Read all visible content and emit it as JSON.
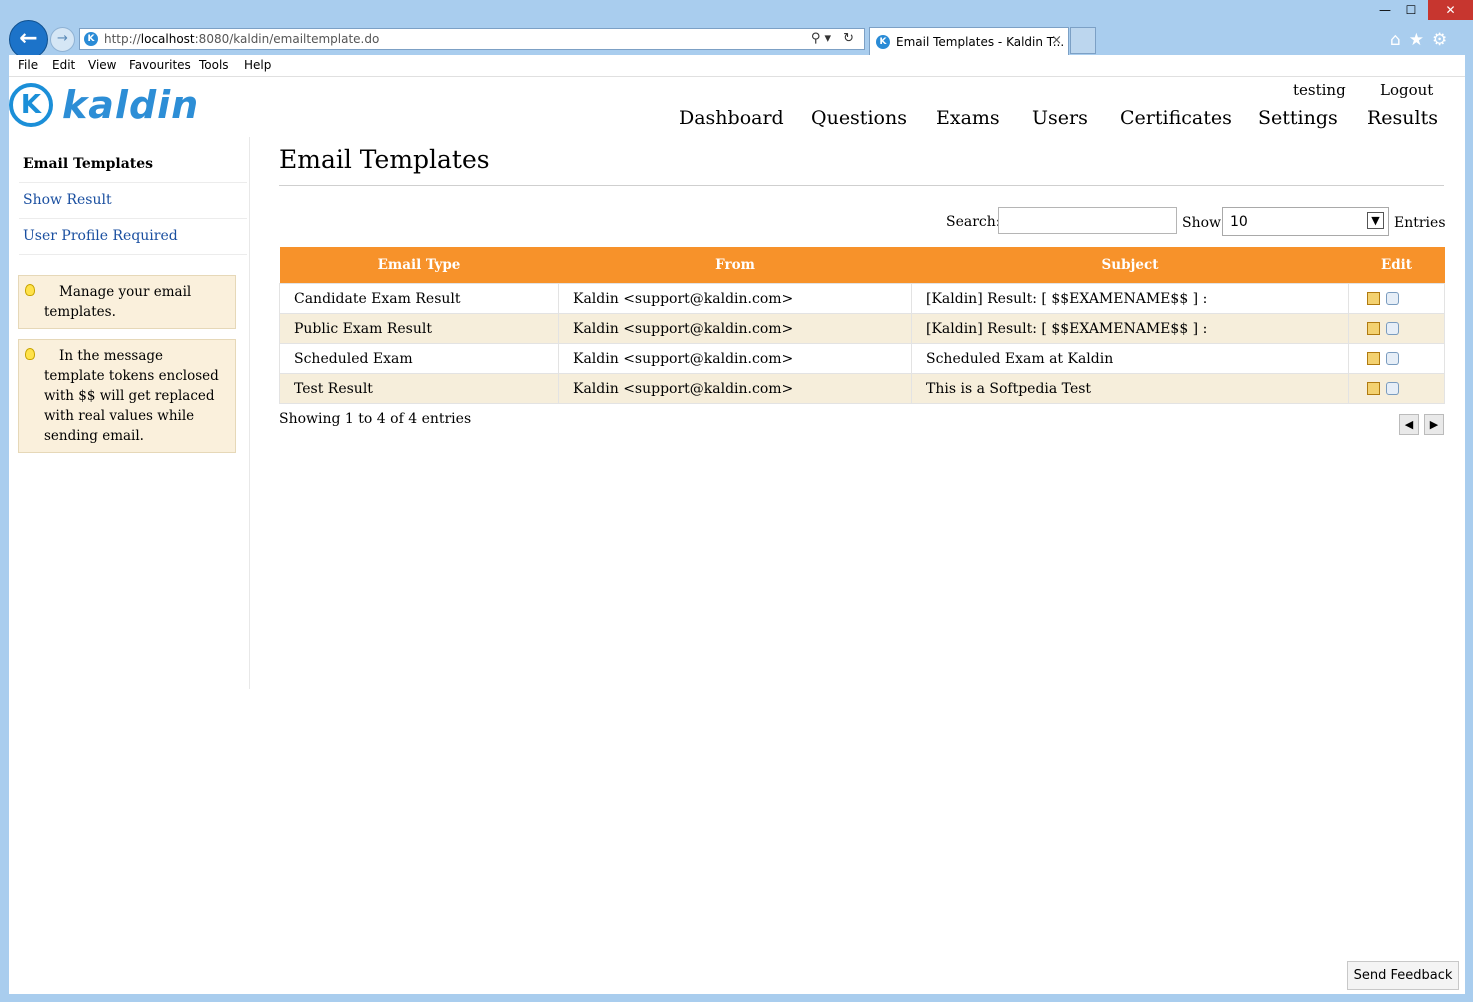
{
  "browser": {
    "url_prefix": "http://",
    "url_host": "localhost",
    "url_rest": ":8080/kaldin/emailtemplate.do",
    "tab_title": "Email Templates - Kaldin T...",
    "tab_close": "×",
    "menu": [
      "File",
      "Edit",
      "View",
      "Favourites",
      "Tools",
      "Help"
    ],
    "window_controls": {
      "minimize": "—",
      "maximize": "☐",
      "close": "✕"
    },
    "toolbar_icons": [
      "home-icon",
      "star-icon",
      "gear-icon"
    ],
    "address_tools": "⚲▾ ↻"
  },
  "header": {
    "logo_text": "kaldin",
    "logo_mark": "K",
    "user": "testing",
    "logout": "Logout",
    "nav": [
      "Dashboard",
      "Questions",
      "Exams",
      "Users",
      "Certificates",
      "Settings",
      "Results"
    ]
  },
  "sidebar": {
    "items": [
      "Email Templates",
      "Show Result",
      "User Profile Required"
    ],
    "tips": [
      "Manage your email templates.",
      "In the message template tokens enclosed with $$ will get replaced with real values while sending email."
    ]
  },
  "main": {
    "title": "Email Templates",
    "search_label": "Search:",
    "show_label": "Show",
    "page_size": "10",
    "entries_label": "Entries",
    "columns": [
      "Email Type",
      "From",
      "Subject",
      "Edit"
    ],
    "rows": [
      {
        "type": "Candidate Exam Result",
        "from": "Kaldin <support@kaldin.com>",
        "subject": "[Kaldin] Result: [ $$EXAMENAME$$ ] :"
      },
      {
        "type": "Public Exam Result",
        "from": "Kaldin <support@kaldin.com>",
        "subject": "[Kaldin] Result: [ $$EXAMENAME$$ ] :"
      },
      {
        "type": "Scheduled Exam",
        "from": "Kaldin <support@kaldin.com>",
        "subject": "Scheduled Exam at Kaldin"
      },
      {
        "type": "Test Result",
        "from": "Kaldin <support@kaldin.com>",
        "subject": "This is a Softpedia Test"
      }
    ],
    "showing": "Showing 1 to 4 of 4 entries",
    "pager_prev": "◀",
    "pager_next": "▶"
  },
  "feedback": "Send Feedback"
}
